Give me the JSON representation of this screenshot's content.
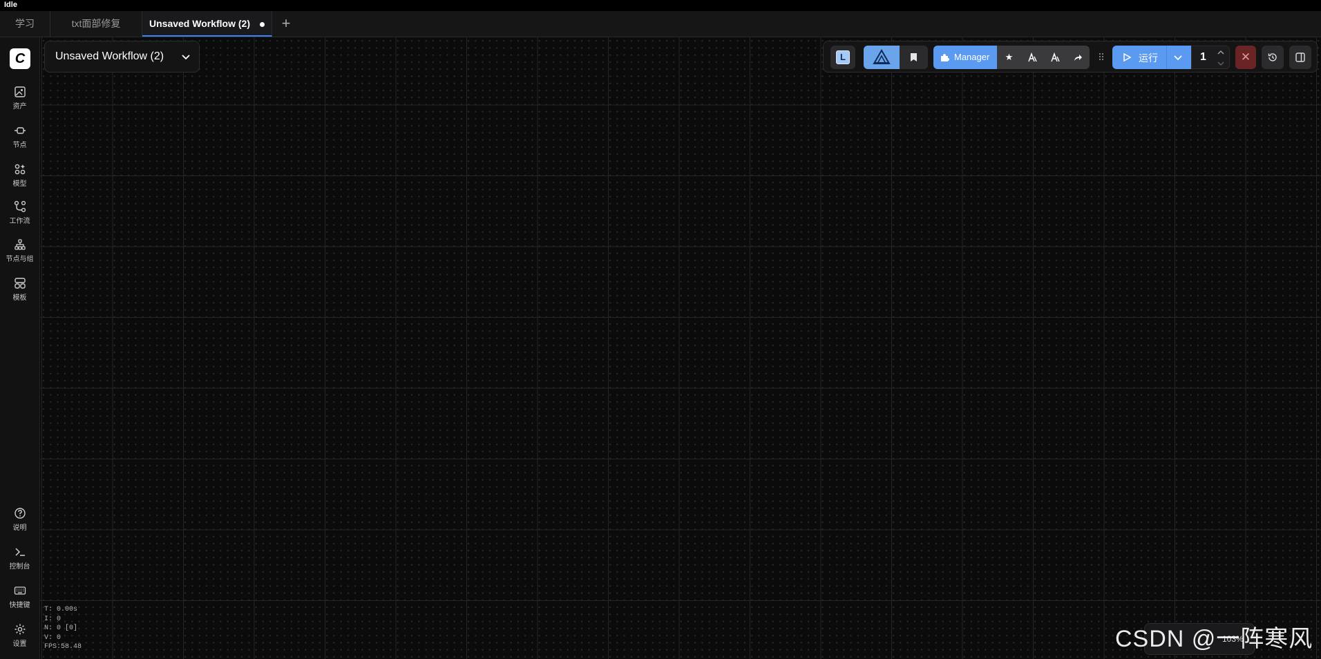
{
  "window": {
    "status": "Idle"
  },
  "tabs": [
    {
      "label": "学习"
    },
    {
      "label": "txt面部修复"
    },
    {
      "label": "Unsaved Workflow (2)"
    }
  ],
  "workflow": {
    "title": "Unsaved Workflow (2)"
  },
  "sidebar": {
    "items": [
      {
        "label": "资产",
        "icon": "image-icon"
      },
      {
        "label": "节点",
        "icon": "node-icon"
      },
      {
        "label": "模型",
        "icon": "model-icon"
      },
      {
        "label": "工作流",
        "icon": "workflow-icon"
      },
      {
        "label": "节点与组",
        "icon": "node-group-icon"
      },
      {
        "label": "模板",
        "icon": "template-icon"
      }
    ],
    "bottom": [
      {
        "label": "说明",
        "icon": "help-icon"
      },
      {
        "label": "控制台",
        "icon": "terminal-icon"
      },
      {
        "label": "快捷键",
        "icon": "keyboard-icon"
      },
      {
        "label": "设置",
        "icon": "gear-icon"
      }
    ]
  },
  "toolbar": {
    "l_badge": "L",
    "manager_label": "Manager",
    "run_label": "运行",
    "queue_count": "1",
    "stop_symbol": "✕"
  },
  "stats": {
    "t": "T: 0.00s",
    "i": "I: 0",
    "n": "N: 0 [0]",
    "v": "V: 0",
    "fps": "FPS:58.48"
  },
  "zoom": {
    "percent": "103%"
  },
  "watermark": "CSDN @一阵寒风",
  "colors": {
    "accent": "#5a9af0",
    "stop": "#6b2425"
  }
}
